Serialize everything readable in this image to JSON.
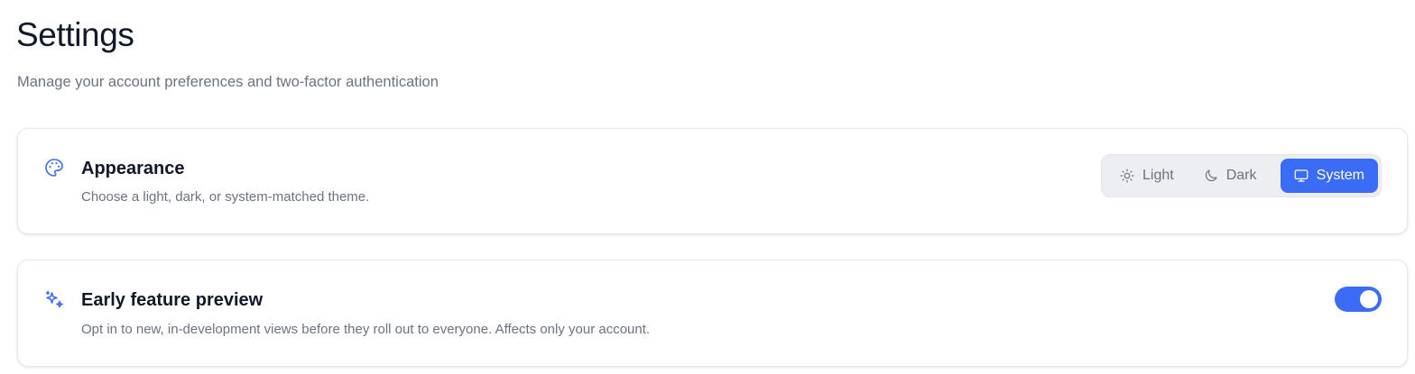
{
  "header": {
    "title": "Settings",
    "subtitle": "Manage your account preferences and two-factor authentication"
  },
  "appearance": {
    "icon": "palette-icon",
    "title": "Appearance",
    "description": "Choose a light, dark, or system-matched theme.",
    "theme_options": [
      {
        "label": "Light",
        "icon": "sun-icon",
        "selected": false
      },
      {
        "label": "Dark",
        "icon": "moon-icon",
        "selected": false
      },
      {
        "label": "System",
        "icon": "monitor-icon",
        "selected": true
      }
    ]
  },
  "early_preview": {
    "icon": "sparkles-icon",
    "title": "Early feature preview",
    "description": "Opt in to new, in-development views before they roll out to everyone. Affects only your account.",
    "enabled": true
  },
  "colors": {
    "accent": "#3b6cf6",
    "text_primary": "#111827",
    "text_secondary": "#6b7280",
    "segment_background": "#eceef1"
  }
}
